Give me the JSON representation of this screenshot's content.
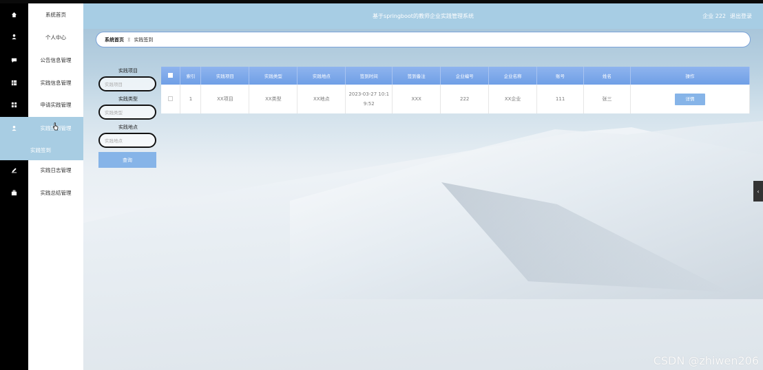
{
  "header": {
    "title": "基于springboot的教师企业实践管理系统",
    "user": "企业 222",
    "logout": "退出登录"
  },
  "sidebar": {
    "items": [
      {
        "label": "系统首页",
        "icon": "home-icon"
      },
      {
        "label": "个人中心",
        "icon": "person-icon"
      },
      {
        "label": "公告信息管理",
        "icon": "message-icon"
      },
      {
        "label": "实践信息管理",
        "icon": "grid-icon"
      },
      {
        "label": "申请实践管理",
        "icon": "apps-icon"
      },
      {
        "label": "实践签到管理",
        "icon": "person-icon"
      },
      {
        "label": "实践日志管理",
        "icon": "edit-icon"
      },
      {
        "label": "实践总结管理",
        "icon": "briefcase-icon"
      }
    ],
    "sub_item": "实践签到"
  },
  "breadcrumb": {
    "home": "系统首页",
    "separator": "Ξ",
    "current": "实践签到"
  },
  "search": {
    "project_label": "实践项目",
    "project_placeholder": "实践项目",
    "type_label": "实践类型",
    "type_placeholder": "实践类型",
    "location_label": "实践地点",
    "location_placeholder": "实践地点",
    "button": "查询"
  },
  "table": {
    "headers": [
      "索引",
      "实践项目",
      "实践类型",
      "实践地点",
      "签到时间",
      "签到备注",
      "企业编号",
      "企业名称",
      "账号",
      "姓名",
      "操作"
    ],
    "rows": [
      {
        "index": "1",
        "project": "XX项目",
        "type": "XX类型",
        "location": "XX地点",
        "time": "2023-03-27 10:19:52",
        "remark": "XXX",
        "company_no": "222",
        "company_name": "XX企业",
        "account": "111",
        "name": "张三",
        "action": "详情"
      }
    ]
  },
  "collapse_glyph": "‹",
  "watermark": "CSDN @zhiwen206",
  "colors": {
    "header_bg": "#a7cde4",
    "active_item": "#a8cde3",
    "button": "#86b4e8",
    "table_header": "#7ea8ea"
  }
}
